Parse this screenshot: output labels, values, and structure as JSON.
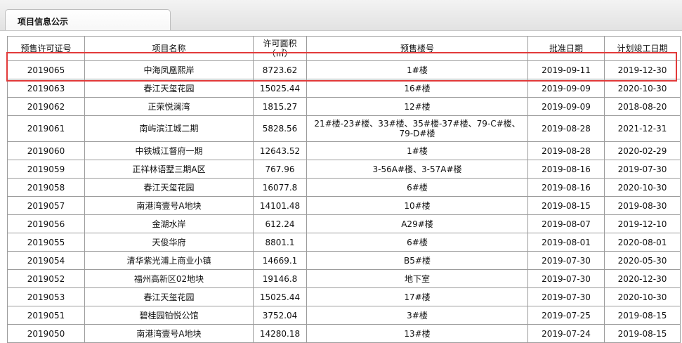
{
  "tab": {
    "label": "项目信息公示"
  },
  "table": {
    "headers": {
      "permit_no": "预售许可证号",
      "project_name": "项目名称",
      "area_line1": "许可面积",
      "area_line2": "（㎡）",
      "buildings": "预售楼号",
      "approval_date": "批准日期",
      "completion_date": "计划竣工日期"
    },
    "rows": [
      {
        "permit_no": "2019065",
        "project_name": "中海凤凰熙岸",
        "area": "8723.62",
        "buildings": "1#楼",
        "approval_date": "2019-09-11",
        "completion_date": "2019-12-30"
      },
      {
        "permit_no": "2019063",
        "project_name": "春江天玺花园",
        "area": "15025.44",
        "buildings": "16#楼",
        "approval_date": "2019-09-09",
        "completion_date": "2020-10-30"
      },
      {
        "permit_no": "2019062",
        "project_name": "正荣悦澜湾",
        "area": "1815.27",
        "buildings": "12#楼",
        "approval_date": "2019-09-09",
        "completion_date": "2018-08-20"
      },
      {
        "permit_no": "2019061",
        "project_name": "南屿滨江城二期",
        "area": "5828.56",
        "buildings": "21#楼-23#楼、33#楼、35#楼-37#楼、79-C#楼、79-D#楼",
        "approval_date": "2019-08-28",
        "completion_date": "2021-12-31"
      },
      {
        "permit_no": "2019060",
        "project_name": "中铁城江督府一期",
        "area": "12643.52",
        "buildings": "1#楼",
        "approval_date": "2019-08-28",
        "completion_date": "2020-02-29"
      },
      {
        "permit_no": "2019059",
        "project_name": "正祥林语墅三期A区",
        "area": "767.96",
        "buildings": "3-56A#楼、3-57A#楼",
        "approval_date": "2019-08-16",
        "completion_date": "2019-07-30"
      },
      {
        "permit_no": "2019058",
        "project_name": "春江天玺花园",
        "area": "16077.8",
        "buildings": "6#楼",
        "approval_date": "2019-08-16",
        "completion_date": "2020-10-30"
      },
      {
        "permit_no": "2019057",
        "project_name": "南港湾壹号A地块",
        "area": "14101.48",
        "buildings": "10#楼",
        "approval_date": "2019-08-15",
        "completion_date": "2019-08-30"
      },
      {
        "permit_no": "2019056",
        "project_name": "金湖水岸",
        "area": "612.24",
        "buildings": "A29#楼",
        "approval_date": "2019-08-07",
        "completion_date": "2019-12-10"
      },
      {
        "permit_no": "2019055",
        "project_name": "天俊华府",
        "area": "8801.1",
        "buildings": "6#楼",
        "approval_date": "2019-08-01",
        "completion_date": "2020-08-01"
      },
      {
        "permit_no": "2019054",
        "project_name": "清华紫光浦上商业小镇",
        "area": "14669.1",
        "buildings": "B5#楼",
        "approval_date": "2019-07-30",
        "completion_date": "2020-05-30"
      },
      {
        "permit_no": "2019052",
        "project_name": "福州高新区02地块",
        "area": "19146.8",
        "buildings": "地下室",
        "approval_date": "2019-07-30",
        "completion_date": "2020-12-30"
      },
      {
        "permit_no": "2019053",
        "project_name": "春江天玺花园",
        "area": "15025.44",
        "buildings": "17#楼",
        "approval_date": "2019-07-30",
        "completion_date": "2020-10-30"
      },
      {
        "permit_no": "2019051",
        "project_name": "碧桂园铂悦公馆",
        "area": "3752.04",
        "buildings": "3#楼",
        "approval_date": "2019-07-25",
        "completion_date": "2019-08-15"
      },
      {
        "permit_no": "2019050",
        "project_name": "南港湾壹号A地块",
        "area": "14280.18",
        "buildings": "13#楼",
        "approval_date": "2019-07-24",
        "completion_date": "2019-08-15"
      }
    ]
  },
  "colors": {
    "highlight_border": "#e23a3a",
    "grid_border": "#9c9c9c"
  }
}
